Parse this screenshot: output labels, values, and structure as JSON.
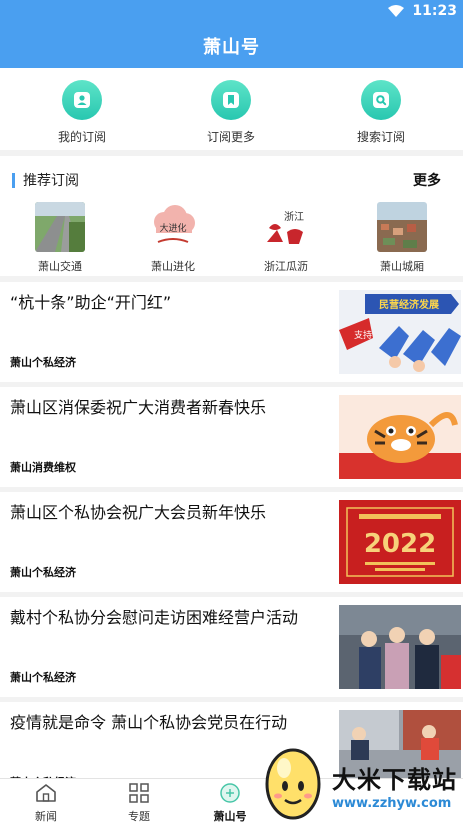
{
  "status": {
    "time": "11:23"
  },
  "header": {
    "title": "萧山号"
  },
  "quick_actions": [
    {
      "label": "我的订阅",
      "icon": "person-icon"
    },
    {
      "label": "订阅更多",
      "icon": "bookmark-icon"
    },
    {
      "label": "搜索订阅",
      "icon": "search-icon"
    }
  ],
  "recommend": {
    "title": "推荐订阅",
    "more": "更多",
    "items": [
      {
        "label": "萧山交通"
      },
      {
        "label": "萧山进化",
        "logo_text": "大进化"
      },
      {
        "label": "浙江瓜沥",
        "logo_text": "浙江"
      },
      {
        "label": "萧山城厢"
      }
    ]
  },
  "news": [
    {
      "title": "“杭十条”助企“开门红”",
      "tag": "萧山个私经济",
      "banner_text": "民营经济发展",
      "sign_text": "支持"
    },
    {
      "title": "萧山区消保委祝广大消费者新春快乐",
      "tag": "萧山消费维权"
    },
    {
      "title": "萧山区个私协会祝广大会员新年快乐",
      "tag": "萧山个私经济",
      "year_text": "2022"
    },
    {
      "title": "戴村个私协分会慰问走访困难经营户活动",
      "tag": "萧山个私经济"
    },
    {
      "title": "疫情就是命令 萧山个私协会党员在行动",
      "tag": "萧山个私经济"
    }
  ],
  "tabs": [
    {
      "label": "新闻",
      "icon": "home-icon"
    },
    {
      "label": "专题",
      "icon": "grid-icon"
    },
    {
      "label": "萧山号",
      "icon": "xiaoshanhao-icon",
      "active": true
    }
  ],
  "watermark": {
    "text": "大米下载站",
    "url": "www.zzhyw.com"
  },
  "colors": {
    "primary": "#4a9ff0",
    "accent": "#28c7b0"
  }
}
